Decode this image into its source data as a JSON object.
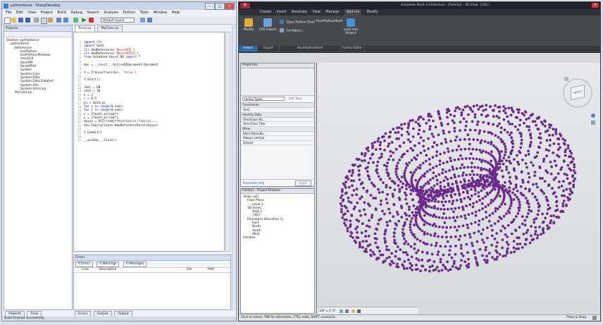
{
  "sharpdevelop": {
    "window_title": "pythontorus - SharpDevelop",
    "menu": [
      "File",
      "Edit",
      "View",
      "Project",
      "Build",
      "Debug",
      "Search",
      "Analysis",
      "Python",
      "Tools",
      "Window",
      "Help"
    ],
    "layout_select": "Default layout",
    "projects_panel_title": "Projects",
    "tree": [
      "Solution 'pythontorus'",
      "pythontorus",
      "References",
      "IronPython",
      "IronPython.Modules",
      "mscorlib",
      "RevitAPI",
      "RevitAPIUI",
      "System",
      "System.Core",
      "System.Data",
      "System.Data.DataSet",
      "System.Xml",
      "System.Xml.Linq",
      "MyClass.py"
    ],
    "editor_tabs": [
      "Torus.py",
      "MyClass.py"
    ],
    "code_lines": [
      "import clr",
      "import math",
      "clr.AddReference('RevitAPI')",
      "clr.AddReference('RevitAPIUI')",
      "from Autodesk.Revit.DB import *",
      "",
      "doc = __revit__.ActiveUIDocument.Document",
      "",
      "t = Transaction(doc, 'torus')",
      "",
      "t.Start()",
      "",
      "rmaj = 60",
      "rmin = 30",
      "n = 2",
      "r = 0.5",
      "pi = math.pi",
      "for u in range(0,num):",
      "    for j in range(0,num):",
      "        u = 2*math.pi/num*i",
      "        v = 2*math.pi/num*j",
      "        myxyz = XYZ((rmaj+rmin*cos(v))*cos(u),...",
      "        doc.FamilyCreate.NewReferencePoint(myxyz)",
      "",
      "t.Commit()",
      "",
      "__window__.Close()"
    ],
    "errors_panel_title": "Errors",
    "errors_filters": [
      "0 Errors",
      "0 Warnings",
      "0 Messages"
    ],
    "errors_columns": [
      "Line",
      "Description",
      "File",
      "Path"
    ],
    "bottom_tabs_left": [
      "Projects",
      "Tools"
    ],
    "bottom_tabs_right": [
      "Errors",
      "Output",
      "Output"
    ],
    "status_text": "Build finished successfully."
  },
  "revit": {
    "window_title": "Autodesk Revit Architecture - [Family1 - 3D View: {3D}]",
    "ribbon_tabs": [
      "Create",
      "Insert",
      "Annotate",
      "View",
      "Manage",
      "Add-Ins",
      "Modify"
    ],
    "ribbon_buttons": [
      "Modify",
      "CSS Export",
      "Open Python Shell",
      "Configure...",
      "RevitPythonShell",
      "Load into Project"
    ],
    "ribbon_groups": [
      "Select",
      "Export",
      "RevitPythonShell",
      "Family Editor"
    ],
    "properties_title": "Properties",
    "family_types": "Family Types",
    "edit_type": "Edit Type",
    "prop_groups": [
      {
        "name": "Constraints",
        "rows": [
          "Host"
        ]
      },
      {
        "name": "Identity Data",
        "rows": [
          "OmniClass Nu...",
          "OmniClass Title"
        ]
      },
      {
        "name": "Other",
        "rows": [
          "Work Plane-Ba...",
          "Always vertical",
          "Shared"
        ]
      }
    ],
    "properties_help": "Properties help",
    "apply_label": "Apply",
    "browser_title": "Family1 - Project Browser",
    "browser_tree": [
      "Views (all)",
      "Floor Plans",
      "Level 1",
      "3D Views",
      "View 1",
      "{3D}",
      "Elevations (Elevation 1)",
      "East",
      "North",
      "South",
      "West",
      "Families"
    ],
    "view_scale": "1/4\" = 1'-0\"",
    "status_text": "Click to select, TAB for alternates, CTRL adds, SHIFT unselects.",
    "press_drag": "Press & Drag",
    "viewcube_label": "FRONT",
    "point_color": "#6a2a8a"
  }
}
